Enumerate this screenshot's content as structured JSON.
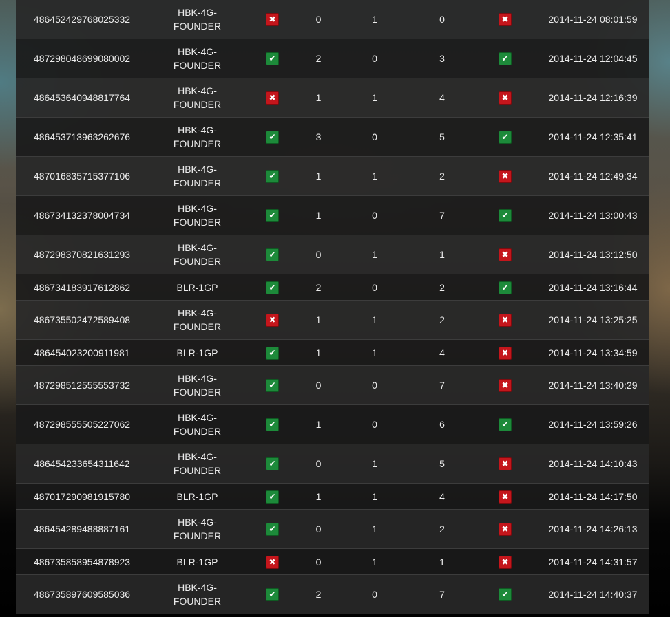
{
  "icons": {
    "ok": "✔",
    "bad": "✖",
    "ok_color": "#1d8a3a",
    "bad_color": "#c4161c"
  },
  "rows": [
    {
      "id": "486452429768025332",
      "mech": [
        "HBK-4G-",
        "FOUNDER"
      ],
      "s1": "bad",
      "a": "0",
      "b": "1",
      "c": "0",
      "s2": "bad",
      "time": "2014-11-24 08:01:59"
    },
    {
      "id": "487298048699080002",
      "mech": [
        "HBK-4G-",
        "FOUNDER"
      ],
      "s1": "ok",
      "a": "2",
      "b": "0",
      "c": "3",
      "s2": "ok",
      "time": "2014-11-24 12:04:45"
    },
    {
      "id": "486453640948817764",
      "mech": [
        "HBK-4G-",
        "FOUNDER"
      ],
      "s1": "bad",
      "a": "1",
      "b": "1",
      "c": "4",
      "s2": "bad",
      "time": "2014-11-24 12:16:39"
    },
    {
      "id": "486453713963262676",
      "mech": [
        "HBK-4G-",
        "FOUNDER"
      ],
      "s1": "ok",
      "a": "3",
      "b": "0",
      "c": "5",
      "s2": "ok",
      "time": "2014-11-24 12:35:41"
    },
    {
      "id": "487016835715377106",
      "mech": [
        "HBK-4G-",
        "FOUNDER"
      ],
      "s1": "ok",
      "a": "1",
      "b": "1",
      "c": "2",
      "s2": "bad",
      "time": "2014-11-24 12:49:34"
    },
    {
      "id": "486734132378004734",
      "mech": [
        "HBK-4G-",
        "FOUNDER"
      ],
      "s1": "ok",
      "a": "1",
      "b": "0",
      "c": "7",
      "s2": "ok",
      "time": "2014-11-24 13:00:43"
    },
    {
      "id": "487298370821631293",
      "mech": [
        "HBK-4G-",
        "FOUNDER"
      ],
      "s1": "ok",
      "a": "0",
      "b": "1",
      "c": "1",
      "s2": "bad",
      "time": "2014-11-24 13:12:50"
    },
    {
      "id": "486734183917612862",
      "mech": [
        "BLR-1GP"
      ],
      "s1": "ok",
      "a": "2",
      "b": "0",
      "c": "2",
      "s2": "ok",
      "time": "2014-11-24 13:16:44"
    },
    {
      "id": "486735502472589408",
      "mech": [
        "HBK-4G-",
        "FOUNDER"
      ],
      "s1": "bad",
      "a": "1",
      "b": "1",
      "c": "2",
      "s2": "bad",
      "time": "2014-11-24 13:25:25"
    },
    {
      "id": "486454023200911981",
      "mech": [
        "BLR-1GP"
      ],
      "s1": "ok",
      "a": "1",
      "b": "1",
      "c": "4",
      "s2": "bad",
      "time": "2014-11-24 13:34:59"
    },
    {
      "id": "487298512555553732",
      "mech": [
        "HBK-4G-",
        "FOUNDER"
      ],
      "s1": "ok",
      "a": "0",
      "b": "0",
      "c": "7",
      "s2": "bad",
      "time": "2014-11-24 13:40:29"
    },
    {
      "id": "487298555505227062",
      "mech": [
        "HBK-4G-",
        "FOUNDER"
      ],
      "s1": "ok",
      "a": "1",
      "b": "0",
      "c": "6",
      "s2": "ok",
      "time": "2014-11-24 13:59:26"
    },
    {
      "id": "486454233654311642",
      "mech": [
        "HBK-4G-",
        "FOUNDER"
      ],
      "s1": "ok",
      "a": "0",
      "b": "1",
      "c": "5",
      "s2": "bad",
      "time": "2014-11-24 14:10:43"
    },
    {
      "id": "487017290981915780",
      "mech": [
        "BLR-1GP"
      ],
      "s1": "ok",
      "a": "1",
      "b": "1",
      "c": "4",
      "s2": "bad",
      "time": "2014-11-24 14:17:50"
    },
    {
      "id": "486454289488887161",
      "mech": [
        "HBK-4G-",
        "FOUNDER"
      ],
      "s1": "ok",
      "a": "0",
      "b": "1",
      "c": "2",
      "s2": "bad",
      "time": "2014-11-24 14:26:13"
    },
    {
      "id": "486735858954878923",
      "mech": [
        "BLR-1GP"
      ],
      "s1": "bad",
      "a": "0",
      "b": "1",
      "c": "1",
      "s2": "bad",
      "time": "2014-11-24 14:31:57"
    },
    {
      "id": "486735897609585036",
      "mech": [
        "HBK-4G-",
        "FOUNDER"
      ],
      "s1": "ok",
      "a": "2",
      "b": "0",
      "c": "7",
      "s2": "ok",
      "time": "2014-11-24 14:40:37"
    }
  ]
}
